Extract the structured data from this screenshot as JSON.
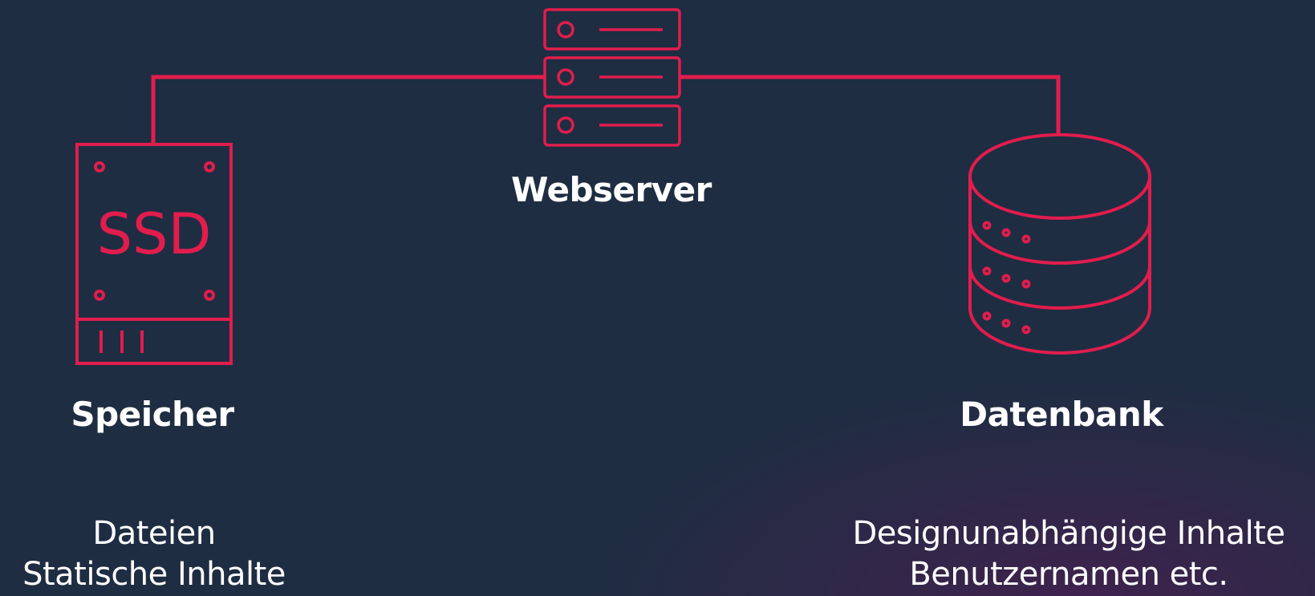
{
  "colors": {
    "accent": "#e11d4d",
    "background": "#1e2d42",
    "text": "#ffffff"
  },
  "nodes": {
    "webserver": {
      "label": "Webserver",
      "icon": "server-rack-icon"
    },
    "storage": {
      "label": "Speicher",
      "icon": "ssd-drive-icon",
      "icon_text": "SSD",
      "description": [
        "Dateien",
        "Statische Inhalte"
      ]
    },
    "database": {
      "label": "Datenbank",
      "icon": "database-cylinder-icon",
      "description": [
        "Designunabhängige Inhalte",
        "Benutzernamen etc."
      ]
    }
  }
}
